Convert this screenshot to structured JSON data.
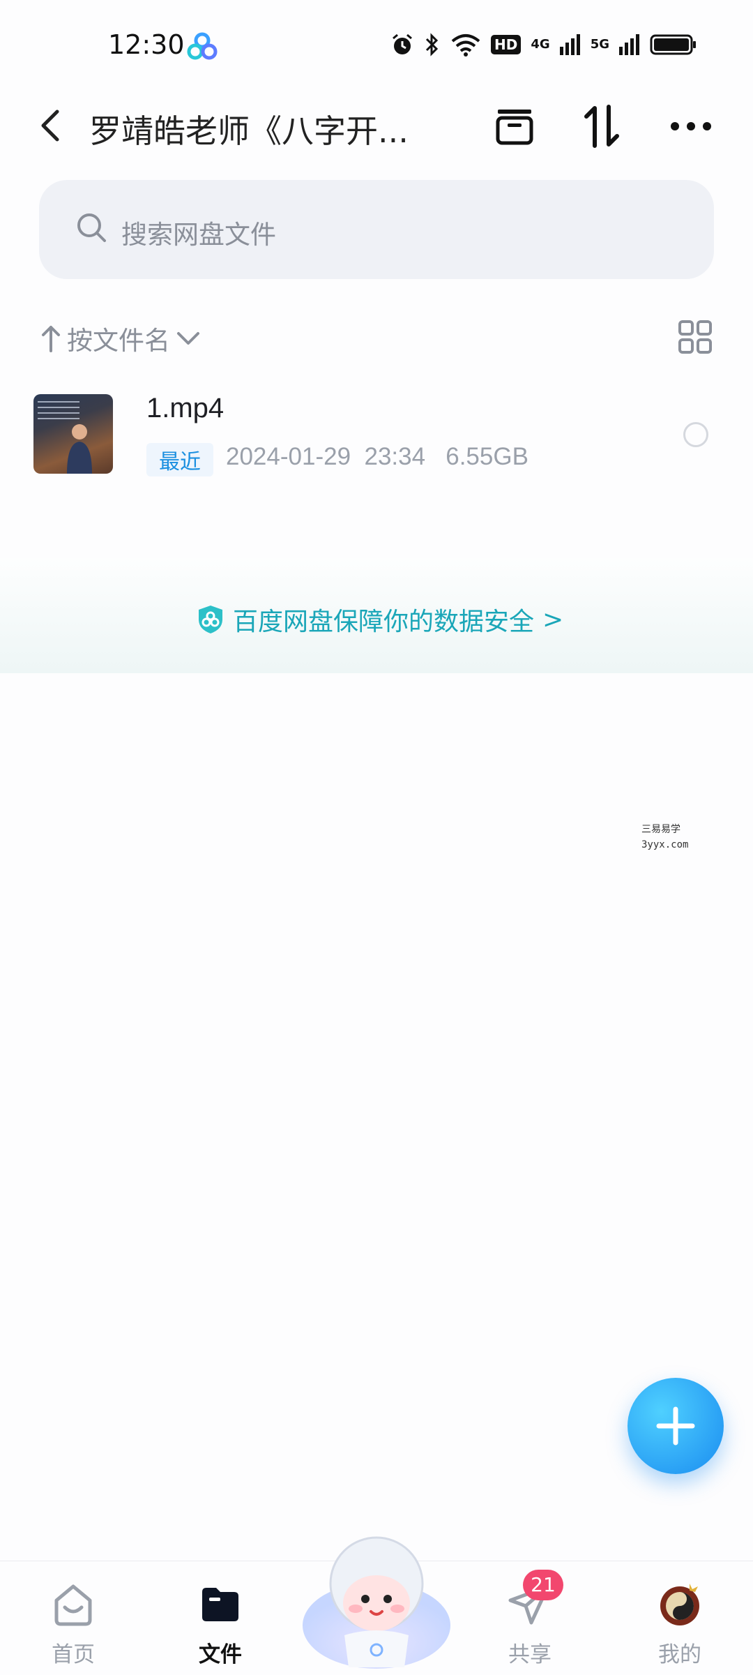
{
  "status_bar": {
    "time": "12:30",
    "hd_label": "HD",
    "net_4g": "4G",
    "net_5g": "5G"
  },
  "header": {
    "title": "罗靖皓老师《八字开...",
    "icons": [
      "back-arrow-icon",
      "archive-icon",
      "sort-swap-icon",
      "more-icon"
    ]
  },
  "search": {
    "placeholder": "搜索网盘文件"
  },
  "sort": {
    "label": "按文件名"
  },
  "files": [
    {
      "name": "1.mp4",
      "badge": "最近",
      "meta": "2024-01-29  23:34   6.55GB"
    }
  ],
  "banner": {
    "text": "百度网盘保障你的数据安全",
    "chevron": ">"
  },
  "watermark": {
    "line1": "三易易学",
    "line2": "3yyx.com"
  },
  "nav": {
    "items": [
      {
        "label": "首页"
      },
      {
        "label": "文件"
      },
      {
        "label": "共享"
      },
      {
        "label": "我的"
      }
    ],
    "share_badge": "21"
  },
  "colors": {
    "accent": "#1a8cf0",
    "banner_text": "#1aa6b8",
    "badge_red": "#f2476e"
  }
}
